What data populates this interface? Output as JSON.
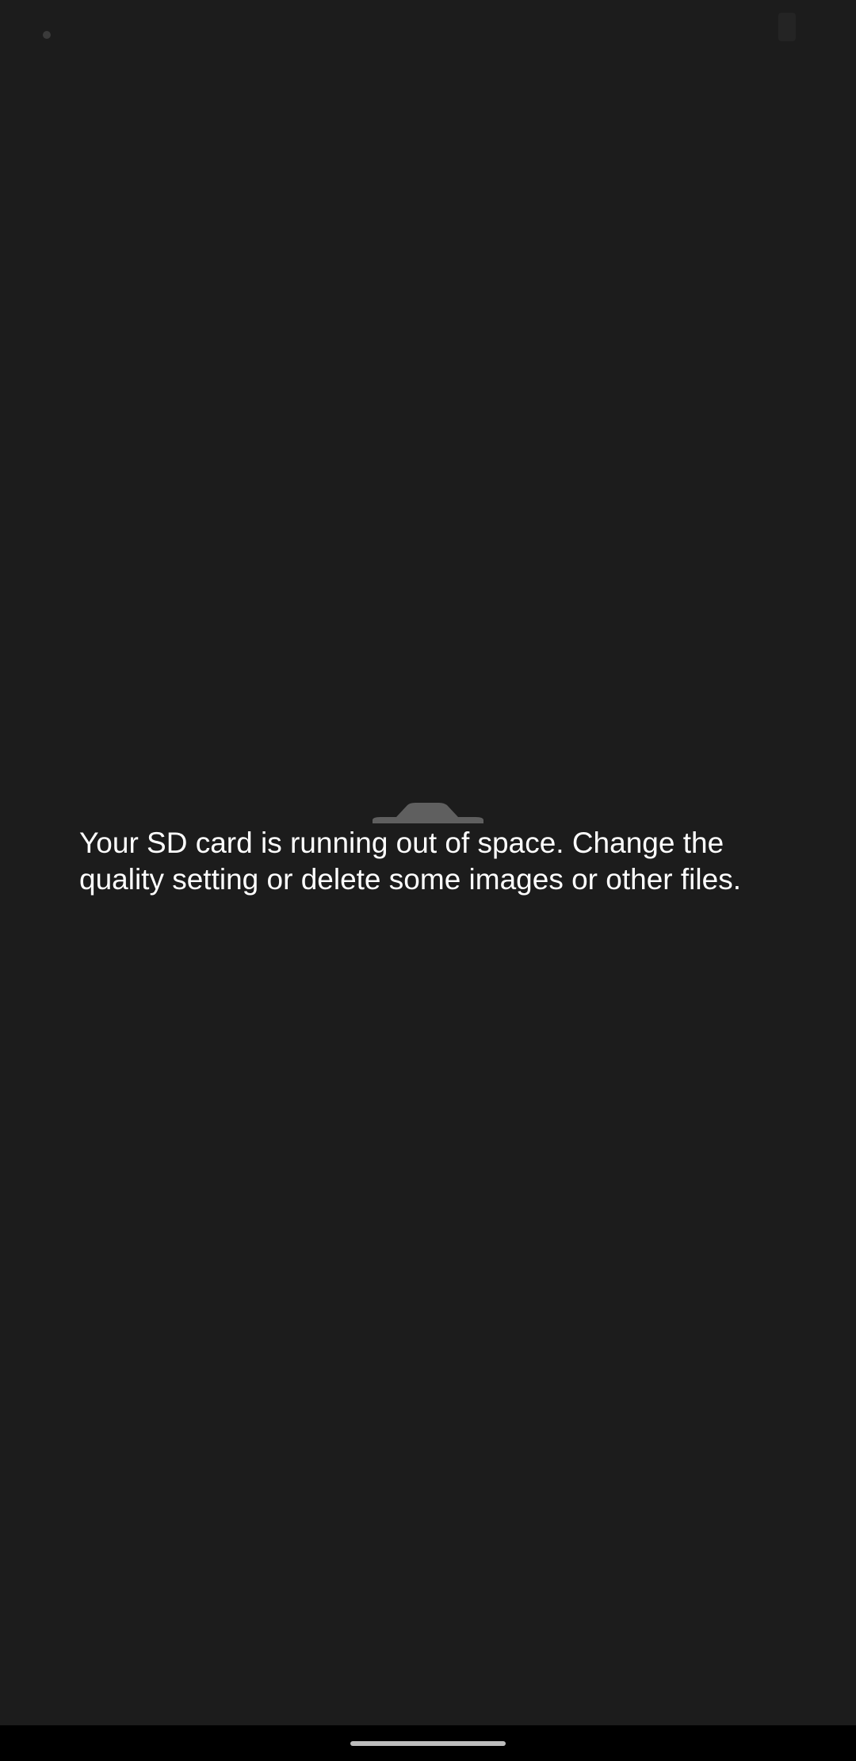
{
  "app": {
    "background_color": "#1c1c1c"
  },
  "status_bar": {
    "left_icon": "notification-dot-icon",
    "right_icon": "battery-icon"
  },
  "storage_warning": {
    "icon": "camera-icon",
    "icon_color": "#5f5f5f",
    "message": "Your SD card is running out of space. Change the quality setting or delete some images or other files."
  },
  "navigation": {
    "handle": "home-gesture-handle",
    "handle_color": "#bdbdbd",
    "bar_color": "#000000"
  }
}
